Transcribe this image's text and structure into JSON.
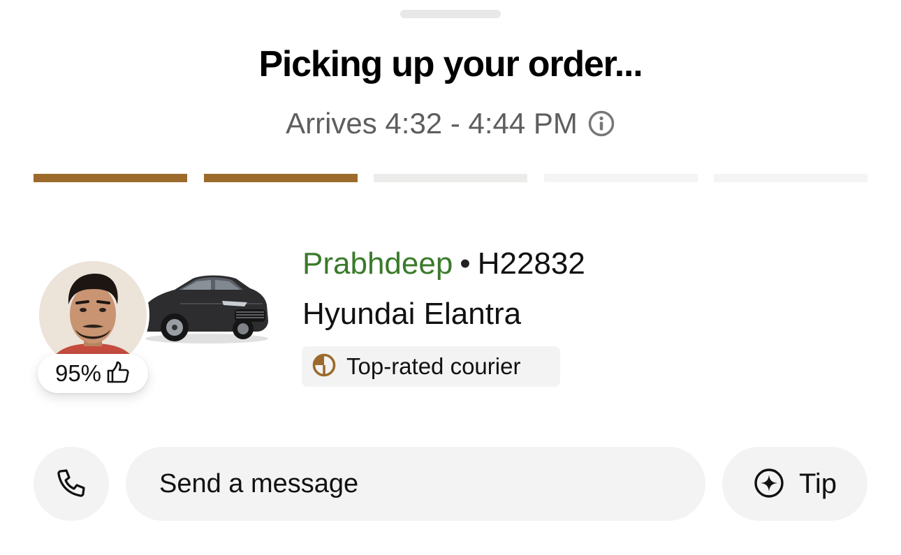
{
  "header": {
    "title": "Picking up your order...",
    "eta": "Arrives 4:32 - 4:44 PM",
    "info_icon": "info-icon"
  },
  "progress": {
    "segments": [
      {
        "fill": 1.0,
        "state": "complete"
      },
      {
        "fill": 1.0,
        "state": "complete"
      },
      {
        "fill": 0.0,
        "state": "active"
      },
      {
        "fill": 0.0,
        "state": "pending"
      },
      {
        "fill": 0.0,
        "state": "pending"
      }
    ],
    "colors": {
      "complete": "#9c6b2c",
      "active": "#ececea",
      "pending": "#f4f4f4"
    }
  },
  "courier": {
    "name": "Prabhdeep",
    "separator": "•",
    "plate": "H22832",
    "vehicle": "Hyundai Elantra",
    "badge_label": "Top-rated courier",
    "badge_icon": "medal-icon",
    "rating": "95%",
    "rating_icon": "thumbs-up-icon",
    "name_color": "#3a7a2a"
  },
  "actions": {
    "call_icon": "phone-icon",
    "message_placeholder": "Send a message",
    "tip_label": "Tip",
    "tip_icon": "sparkle-plus-icon"
  },
  "colors": {
    "accent": "#9c6b2c",
    "surface": "#f3f3f3"
  }
}
